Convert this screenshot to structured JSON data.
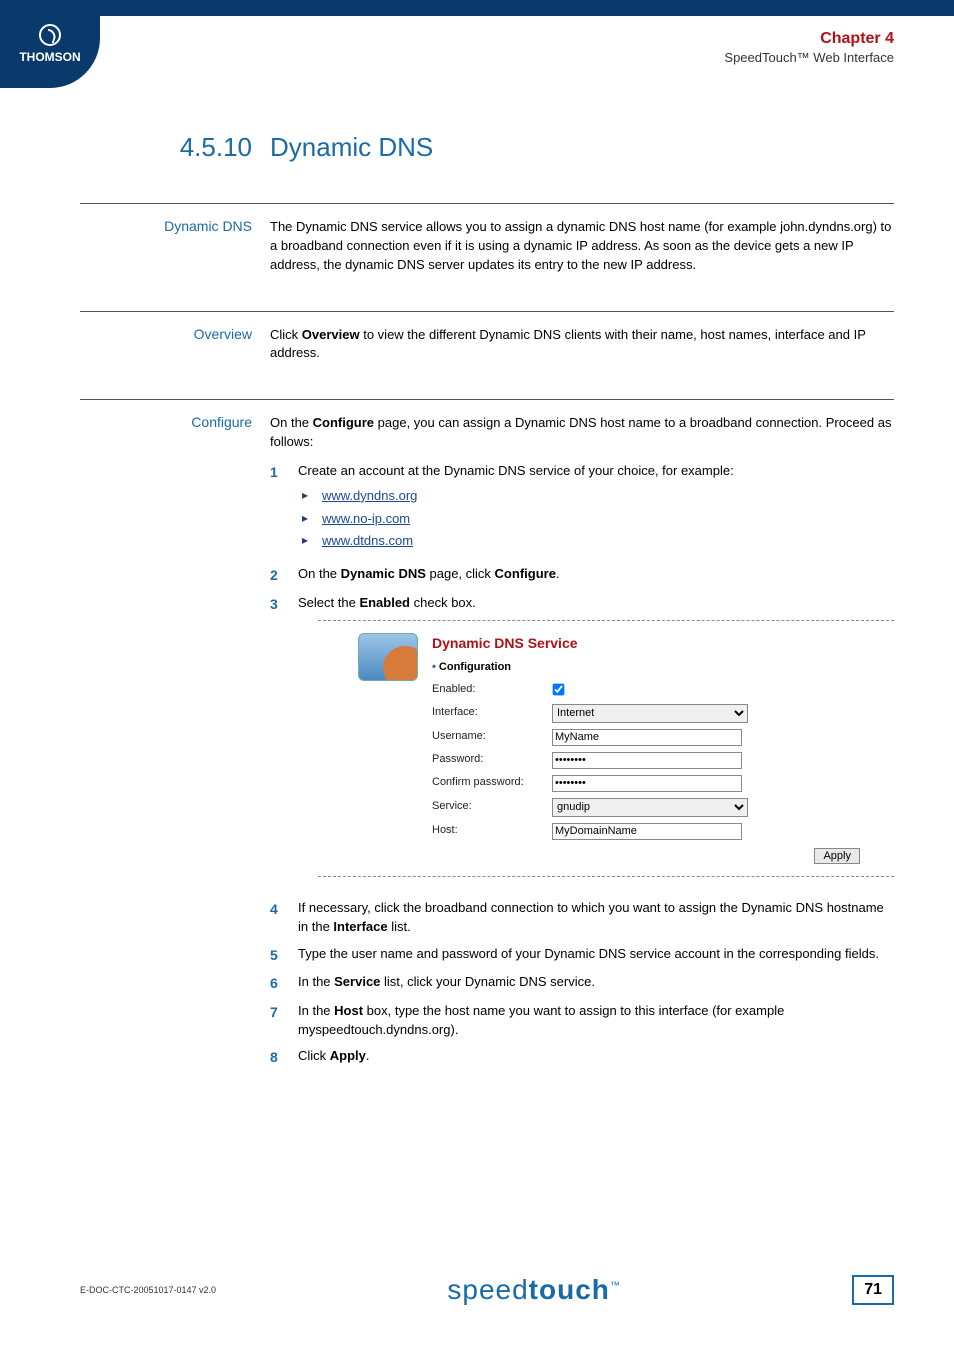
{
  "header": {
    "logo_text": "THOMSON",
    "chapter": "Chapter 4",
    "sub": "SpeedTouch™ Web Interface"
  },
  "title": {
    "number": "4.5.10",
    "text": "Dynamic DNS"
  },
  "sections": {
    "dynamic": {
      "label": "Dynamic DNS",
      "body": "The Dynamic DNS service allows you to assign a dynamic DNS host name (for example john.dyndns.org) to a broadband connection even if it is using a dynamic IP address. As soon as the device gets a new IP address, the dynamic DNS server updates its entry to the new IP address."
    },
    "overview": {
      "label": "Overview",
      "prefix": "Click ",
      "bold": "Overview",
      "suffix": " to view the different Dynamic DNS clients with their name, host names, interface and IP address."
    },
    "configure": {
      "label": "Configure",
      "intro_prefix": "On the ",
      "intro_bold": "Configure",
      "intro_suffix": " page, you can assign a Dynamic DNS host name to a broadband connection. Proceed as follows:",
      "step1": "Create an account at the Dynamic DNS service of your choice, for example:",
      "links": [
        "www.dyndns.org",
        "www.no-ip.com",
        "www.dtdns.com"
      ],
      "step2_pre": "On the ",
      "step2_b1": "Dynamic DNS",
      "step2_mid": " page, click ",
      "step2_b2": "Configure",
      "step2_end": ".",
      "step3_pre": "Select the ",
      "step3_bold": "Enabled",
      "step3_suf": " check box.",
      "step4_pre": "If necessary, click the broadband connection to which you want to assign the Dynamic DNS hostname in the ",
      "step4_bold": "Interface",
      "step4_suf": " list.",
      "step5": "Type the user name and password of your Dynamic DNS service account in the corresponding fields.",
      "step6_pre": "In the ",
      "step6_bold": "Service",
      "step6_suf": " list, click your Dynamic DNS service.",
      "step7_pre": "In the ",
      "step7_bold": "Host",
      "step7_suf": " box, type the host name you want to assign to this interface (for example myspeedtouch.dyndns.org).",
      "step8_pre": "Click ",
      "step8_bold": "Apply",
      "step8_suf": "."
    }
  },
  "screenshot": {
    "title": "Dynamic DNS Service",
    "conf": "Configuration",
    "labels": {
      "enabled": "Enabled:",
      "interface": "Interface:",
      "username": "Username:",
      "password": "Password:",
      "confirm": "Confirm password:",
      "service": "Service:",
      "host": "Host:"
    },
    "values": {
      "interface": "Internet",
      "username": "MyName",
      "password": "••••••••",
      "confirm": "••••••••",
      "service": "gnudip",
      "host": "MyDomainName"
    },
    "apply": "Apply"
  },
  "steps_nums": {
    "n1": "1",
    "n2": "2",
    "n3": "3",
    "n4": "4",
    "n5": "5",
    "n6": "6",
    "n7": "7",
    "n8": "8"
  },
  "footer": {
    "doc": "E-DOC-CTC-20051017-0147 v2.0",
    "brand_pre": "speed",
    "brand_bold": "touch",
    "brand_tm": "™",
    "page": "71"
  }
}
